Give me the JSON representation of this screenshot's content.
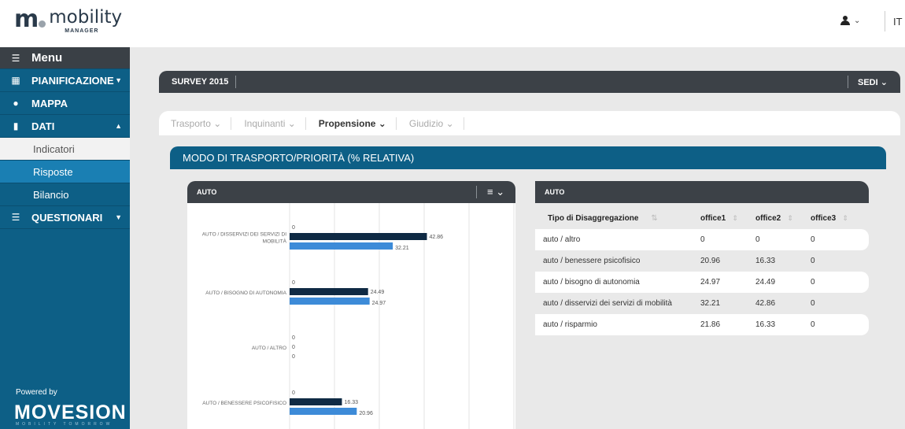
{
  "header": {
    "logo_name": "mobility",
    "logo_sub": "MANAGER",
    "language": "IT"
  },
  "sidebar": {
    "menu_label": "Menu",
    "items": [
      {
        "label": "PIANIFICAZIONE",
        "icon": "calendar-icon"
      },
      {
        "label": "MAPPA",
        "icon": "map-marker-icon"
      },
      {
        "label": "DATI",
        "icon": "bar-chart-icon"
      }
    ],
    "sub_items": [
      "Indicatori",
      "Risposte",
      "Bilancio"
    ],
    "questionari": "QUESTIONARI",
    "powered_by": "Powered by",
    "brand": "MOVESION",
    "brand_sub": "MOBILITY TOMORROW"
  },
  "survey": {
    "title": "SURVEY 2015",
    "sedi": "SEDI"
  },
  "tabs": [
    "Trasporto",
    "Inquinanti",
    "Propensione",
    "Giudizio"
  ],
  "section_title": "MODO DI TRASPORTO/PRIORITÀ (% RELATIVA)",
  "chart_panel": {
    "title": "AUTO"
  },
  "table_panel": {
    "title": "AUTO"
  },
  "chart_data": {
    "type": "bar",
    "orientation": "horizontal",
    "title": "AUTO",
    "xlim": [
      0,
      70
    ],
    "grid": true,
    "categories": [
      "AUTO / DISSERVIZI DEI SERVIZI DI MOBILITÀ",
      "AUTO / BISOGNO DI AUTONOMIA",
      "AUTO / ALTRO",
      "AUTO / BENESSERE PSICOFISICO"
    ],
    "series": [
      {
        "color": "#0f2a44",
        "values": [
          42.86,
          24.49,
          0,
          16.33
        ]
      },
      {
        "color": "#3d8bd8",
        "values": [
          32.21,
          24.97,
          0,
          20.96
        ]
      }
    ],
    "leading_zero_labels": [
      "0",
      "0",
      "0",
      "0"
    ]
  },
  "table": {
    "columns": [
      "Tipo di Disaggregazione",
      "office1",
      "office2",
      "office3"
    ],
    "rows": [
      [
        "auto / altro",
        "0",
        "0",
        "0"
      ],
      [
        "auto / benessere psicofisico",
        "20.96",
        "16.33",
        "0"
      ],
      [
        "auto / bisogno di autonomia",
        "24.97",
        "24.49",
        "0"
      ],
      [
        "auto / disservizi dei servizi di mobilità",
        "32.21",
        "42.86",
        "0"
      ],
      [
        "auto / risparmio",
        "21.86",
        "16.33",
        "0"
      ]
    ]
  }
}
